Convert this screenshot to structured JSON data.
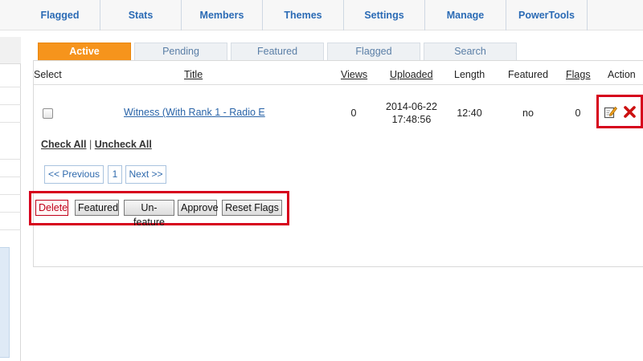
{
  "topnav": {
    "items": [
      {
        "label": "Flagged"
      },
      {
        "label": "Stats"
      },
      {
        "label": "Members"
      },
      {
        "label": "Themes"
      },
      {
        "label": "Settings"
      },
      {
        "label": "Manage"
      },
      {
        "label": "PowerTools"
      }
    ]
  },
  "tabs": [
    {
      "label": "Active",
      "selected": true
    },
    {
      "label": "Pending",
      "selected": false
    },
    {
      "label": "Featured",
      "selected": false
    },
    {
      "label": "Flagged",
      "selected": false
    },
    {
      "label": "Search",
      "selected": false
    }
  ],
  "table": {
    "headers": {
      "select": "Select",
      "title": "Title",
      "views": "Views",
      "uploaded": "Uploaded",
      "length": "Length",
      "featured": "Featured",
      "flags": "Flags",
      "action": "Action"
    },
    "rows": [
      {
        "checked": false,
        "title": "Witness (With Rank 1 - Radio E",
        "views": "0",
        "uploaded_date": "2014-06-22",
        "uploaded_time": "17:48:56",
        "length": "12:40",
        "featured": "no",
        "flags": "0",
        "actions": [
          {
            "icon": "edit-icon"
          },
          {
            "icon": "delete-icon"
          }
        ]
      }
    ]
  },
  "selection": {
    "check_all": "Check All",
    "separator": "|",
    "uncheck_all": "Uncheck All"
  },
  "pagination": {
    "previous": "<< Previous",
    "current_page": "1",
    "next": "Next >>"
  },
  "bulk_actions": {
    "delete": "Delete",
    "featured": "Featured",
    "unfeature": "Un-feature",
    "approve": "Approve",
    "reset_flags": "Reset Flags"
  },
  "colors": {
    "active_tab": "#f6941c",
    "link": "#2a64a8",
    "highlight": "#d6001c"
  }
}
